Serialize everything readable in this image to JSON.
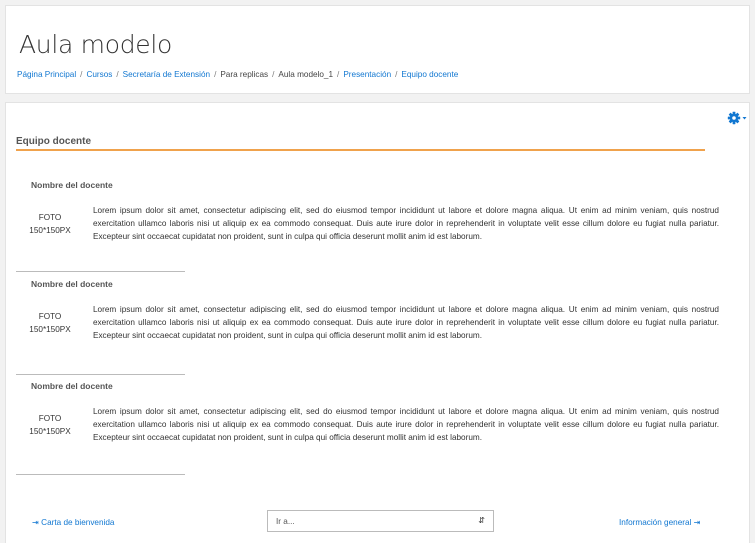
{
  "header": {
    "title": "Aula modelo",
    "breadcrumb": [
      "Página Principal",
      "Cursos",
      "Secretaría de Extensión",
      "Para replicas",
      "Aula modelo_1",
      "Presentación",
      "Equipo docente"
    ]
  },
  "page": {
    "settings_icon": "gear-icon",
    "section_title": "Equipo docente",
    "teachers": [
      {
        "name": "Nombre del docente",
        "photo_line1": "FOTO",
        "photo_line2": "150*150PX",
        "bio": "Lorem ipsum dolor sit amet, consectetur adipiscing elit, sed do eiusmod tempor incididunt ut labore et dolore magna aliqua. Ut enim ad minim veniam, quis nostrud exercitation ullamco laboris nisi ut aliquip ex ea commodo consequat. Duis aute irure dolor in reprehenderit in voluptate velit esse cillum dolore eu fugiat nulla pariatur. Excepteur sint occaecat cupidatat non proident, sunt in culpa qui officia deserunt mollit anim id est laborum."
      },
      {
        "name": "Nombre del docente",
        "photo_line1": "FOTO",
        "photo_line2": "150*150PX",
        "bio": "Lorem ipsum dolor sit amet, consectetur adipiscing elit, sed do eiusmod tempor incididunt ut labore et dolore magna aliqua. Ut enim ad minim veniam, quis nostrud exercitation ullamco laboris nisi ut aliquip ex ea commodo consequat. Duis aute irure dolor in reprehenderit in voluptate velit esse cillum dolore eu fugiat nulla pariatur. Excepteur sint occaecat cupidatat non proident, sunt in culpa qui officia deserunt mollit anim id est laborum."
      },
      {
        "name": "Nombre del docente",
        "photo_line1": "FOTO",
        "photo_line2": "150*150PX",
        "bio": "Lorem ipsum dolor sit amet, consectetur adipiscing elit, sed do eiusmod tempor incididunt ut labore et dolore magna aliqua. Ut enim ad minim veniam, quis nostrud exercitation ullamco laboris nisi ut aliquip ex ea commodo consequat. Duis aute irure dolor in reprehenderit in voluptate velit esse cillum dolore eu fugiat nulla pariatur. Excepteur sint occaecat cupidatat non proident, sunt in culpa qui officia deserunt mollit anim id est laborum."
      }
    ]
  },
  "footer_nav": {
    "prev_icon": "arrow-right-to-bar-icon",
    "prev_label": "Carta de bienvenida",
    "jump_placeholder": "Ir a...",
    "jump_caret_icon": "updown-caret-icon",
    "next_label": "Información general",
    "next_icon": "arrow-right-to-bar-icon"
  },
  "colors": {
    "link": "#1177d1",
    "accent_rule": "#f0a24c"
  }
}
